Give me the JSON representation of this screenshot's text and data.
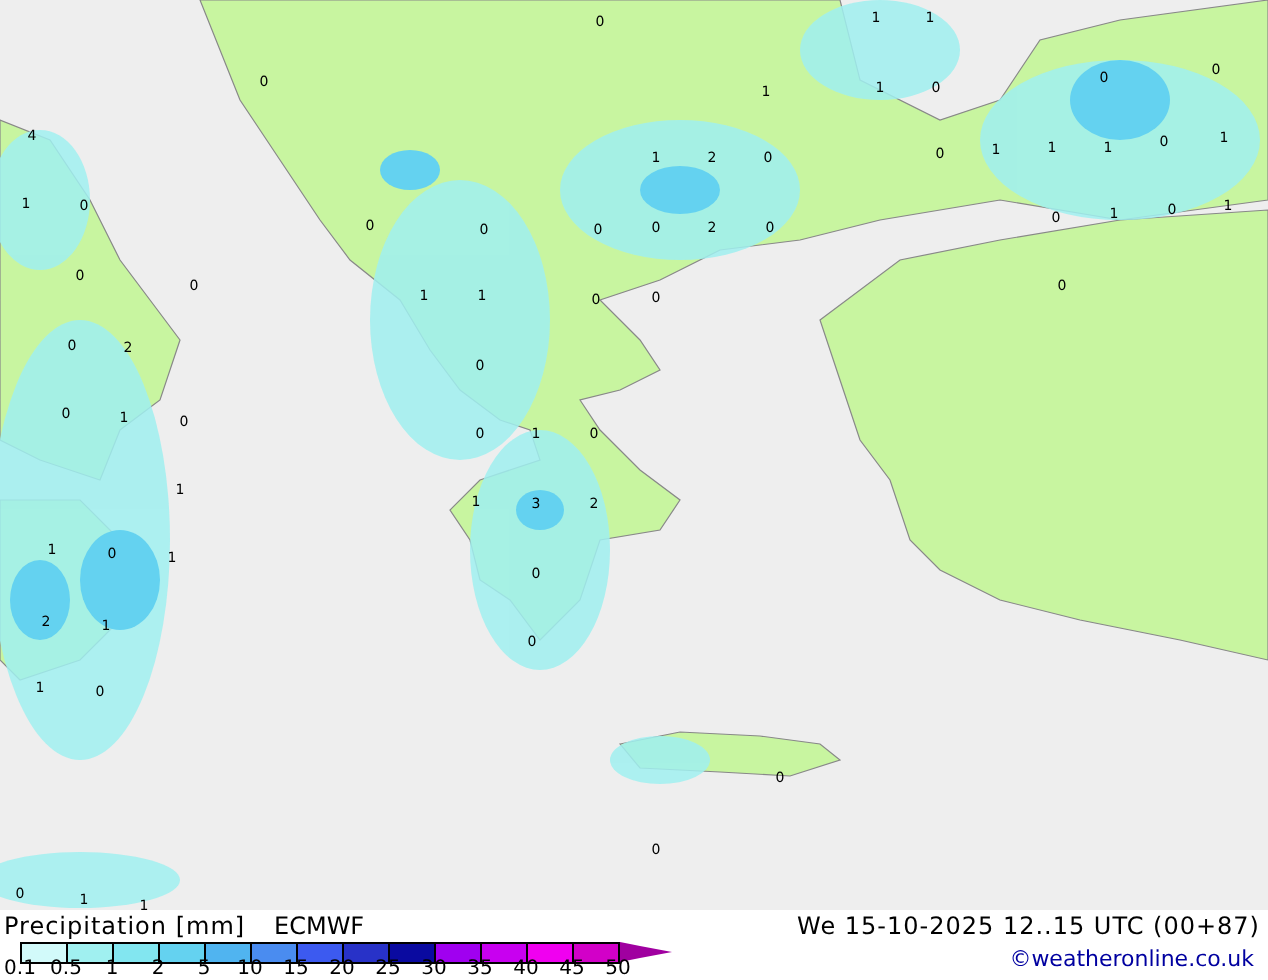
{
  "map": {
    "values": [
      "0",
      "1",
      "1",
      "0",
      "1",
      "1",
      "0",
      "0",
      "0",
      "4",
      "1",
      "2",
      "0",
      "0",
      "1",
      "1",
      "1",
      "0",
      "1",
      "1",
      "0",
      "0",
      "0",
      "0",
      "0",
      "2",
      "0",
      "0",
      "1",
      "0",
      "1",
      "0",
      "0",
      "1",
      "1",
      "0",
      "0",
      "0",
      "0",
      "2",
      "0",
      "0",
      "1",
      "0",
      "0",
      "1",
      "0",
      "1",
      "1",
      "3",
      "2",
      "1",
      "0",
      "1",
      "0",
      "2",
      "1",
      "0",
      "1",
      "0",
      "0",
      "0",
      "0",
      "1",
      "1"
    ]
  },
  "legend": {
    "title": "Precipitation [mm]",
    "model": "ECMWF",
    "bins": [
      {
        "color": "#d2fafa"
      },
      {
        "color": "#a0f0f0"
      },
      {
        "color": "#82e6f0"
      },
      {
        "color": "#64d2f0"
      },
      {
        "color": "#50b4f0"
      },
      {
        "color": "#4a8cf0"
      },
      {
        "color": "#3c5af0"
      },
      {
        "color": "#2832c8"
      },
      {
        "color": "#0a0aa0"
      },
      {
        "color": "#a000f0"
      },
      {
        "color": "#c800f0"
      },
      {
        "color": "#f000f0"
      },
      {
        "color": "#d200c8"
      }
    ],
    "overflow": {
      "color": "#a000a0"
    },
    "ticks": [
      "0.1",
      "0.5",
      "1",
      "2",
      "5",
      "10",
      "15",
      "20",
      "25",
      "30",
      "35",
      "40",
      "45",
      "50"
    ]
  },
  "valid_time": "We 15-10-2025 12..15 UTC (00+87)",
  "credit": "©weatheronline.co.uk"
}
